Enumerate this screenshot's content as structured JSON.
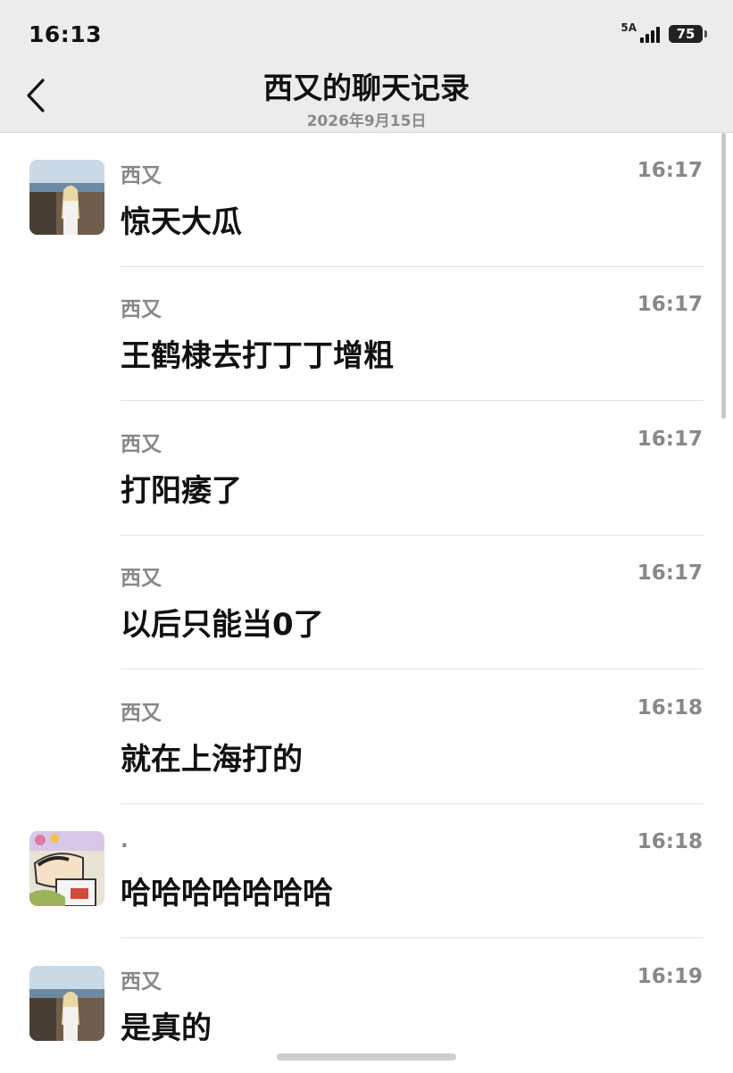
{
  "status_bar": {
    "time": "16:13",
    "network": "5A",
    "battery": "75"
  },
  "header": {
    "title": "西又的聊天记录",
    "subtitle": "2026年9月15日"
  },
  "messages": [
    {
      "sender": "西又",
      "time": "16:17",
      "text": "惊天大瓜",
      "avatar": "girl-photo-avatar"
    },
    {
      "sender": "西又",
      "time": "16:17",
      "text": "王鹤棣去打丁丁增粗",
      "avatar": ""
    },
    {
      "sender": "西又",
      "time": "16:17",
      "text": "打阳痿了",
      "avatar": ""
    },
    {
      "sender": "西又",
      "time": "16:17",
      "text": "以后只能当0了",
      "avatar": ""
    },
    {
      "sender": "西又",
      "time": "16:18",
      "text": "就在上海打的",
      "avatar": ""
    },
    {
      "sender": ".",
      "time": "16:18",
      "text": "哈哈哈哈哈哈哈",
      "avatar": "cartoon-avatar"
    },
    {
      "sender": "西又",
      "time": "16:19",
      "text": "是真的",
      "avatar": "girl-photo-avatar"
    }
  ]
}
